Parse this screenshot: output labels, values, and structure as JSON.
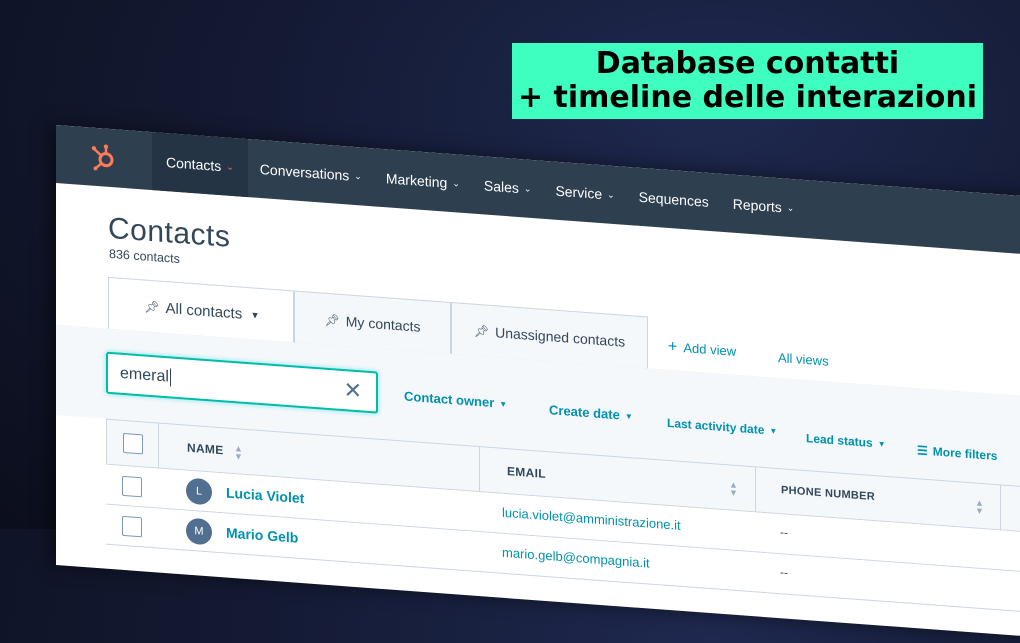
{
  "banner": {
    "line1": "Database contatti",
    "line2": "+ timeline delle interazioni"
  },
  "nav": {
    "logo_icon": "hubspot-sprocket-icon",
    "items": [
      {
        "label": "Contacts",
        "chevron": "⌄"
      },
      {
        "label": "Conversations",
        "chevron": "⌄"
      },
      {
        "label": "Marketing",
        "chevron": "⌄"
      },
      {
        "label": "Sales",
        "chevron": "⌄"
      },
      {
        "label": "Service",
        "chevron": "⌄"
      },
      {
        "label": "Sequences",
        "chevron": ""
      },
      {
        "label": "Reports",
        "chevron": "⌄"
      }
    ]
  },
  "page": {
    "title": "Contacts",
    "count": "836 contacts"
  },
  "tabs": [
    {
      "label": "All contacts",
      "icon": "pin-icon",
      "dropdown": "▾"
    },
    {
      "label": "My contacts",
      "icon": "pin-icon"
    },
    {
      "label": "Unassigned contacts",
      "icon": "pin-icon"
    }
  ],
  "tab_links": {
    "add_view": "Add view",
    "add_view_icon": "+",
    "all_views": "All views"
  },
  "search": {
    "value": "emeral",
    "clear_icon": "✕"
  },
  "filters": [
    {
      "label": "Contact owner"
    },
    {
      "label": "Create date"
    },
    {
      "label": "Last activity date"
    },
    {
      "label": "Lead status"
    },
    {
      "label": "More filters",
      "icon": "sliders-icon"
    }
  ],
  "table": {
    "columns": [
      "NAME",
      "EMAIL",
      "PHONE NUMBER"
    ],
    "rows": [
      {
        "initial": "L",
        "name": "Lucia Violet",
        "email": "lucia.violet@amministrazione.it",
        "phone": "--"
      },
      {
        "initial": "M",
        "name": "Mario Gelb",
        "email": "mario.gelb@compagnia.it",
        "phone": "--"
      }
    ]
  },
  "colors": {
    "nav_bg": "#2e3f50",
    "accent_link": "#0091ae",
    "banner_bg": "#3fffc0",
    "search_border": "#00bda5",
    "hubspot_orange": "#ff7a59"
  }
}
